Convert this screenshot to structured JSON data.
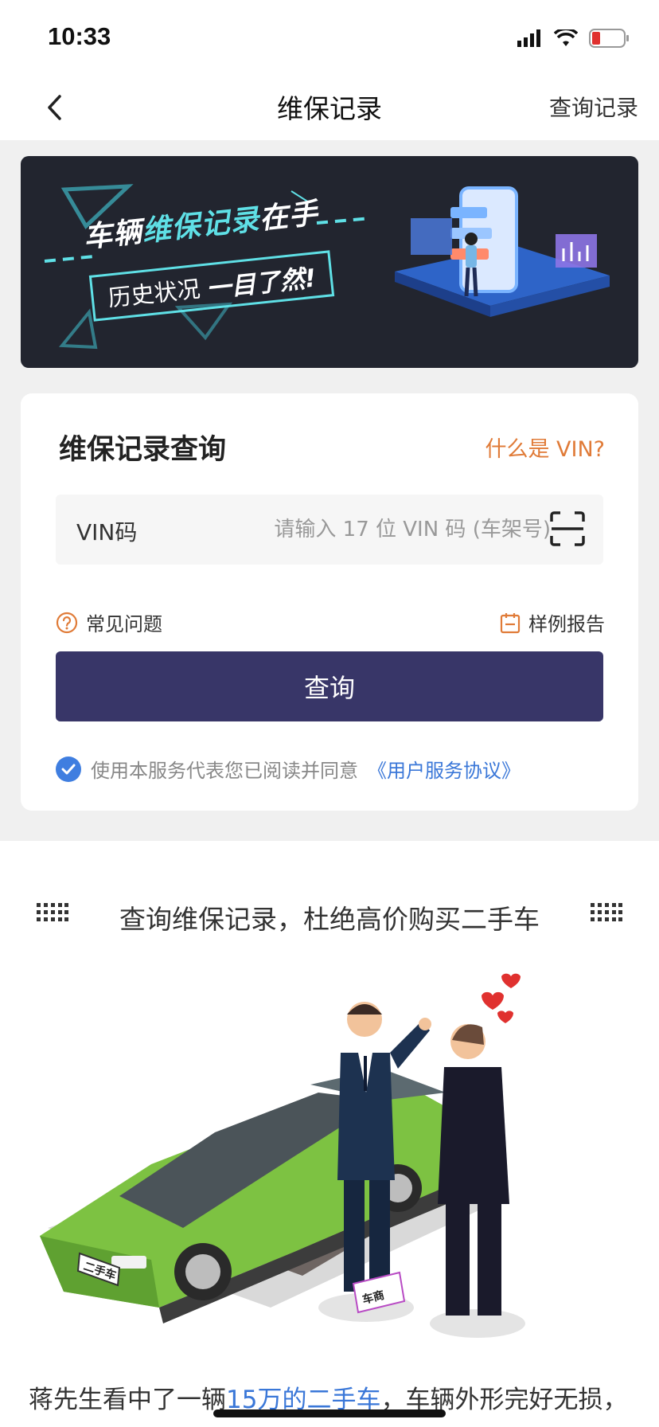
{
  "status_bar": {
    "time": "10:33"
  },
  "nav": {
    "title": "维保记录",
    "right_action": "查询记录"
  },
  "banner": {
    "line1_prefix": "车辆",
    "line1_highlight": "维保记录",
    "line1_suffix": "在手",
    "line2_plain": "历史状况",
    "line2_strong": "一目了然!"
  },
  "query_card": {
    "title": "维保记录查询",
    "help_link": "什么是 VIN?",
    "vin_label": "VIN码",
    "vin_placeholder": "请输入 17 位 VIN 码 (车架号)",
    "faq_label": "常见问题",
    "sample_label": "样例报告",
    "query_button": "查询",
    "agreement_text": "使用本服务代表您已阅读并同意",
    "agreement_link": "《用户服务协议》"
  },
  "info": {
    "title": "查询维保记录，杜绝高价购买二手车",
    "plate_label": "二手车",
    "sign_label": "车商",
    "story_prefix": "蒋先生看中了一辆",
    "story_highlight": "15万的二手车",
    "story_suffix": "，车辆外形完好无损，"
  },
  "colors": {
    "primary_button": "#383668",
    "accent_orange": "#e07b38",
    "link_blue": "#3a77d8",
    "banner_bg": "#22252f",
    "banner_cyan": "#5fe0e6",
    "car_green": "#7dc242"
  },
  "icons": {
    "back": "chevron-left-icon",
    "scan": "scan-icon",
    "faq": "question-circle-icon",
    "sample": "calendar-report-icon",
    "check": "check-circle-icon"
  }
}
